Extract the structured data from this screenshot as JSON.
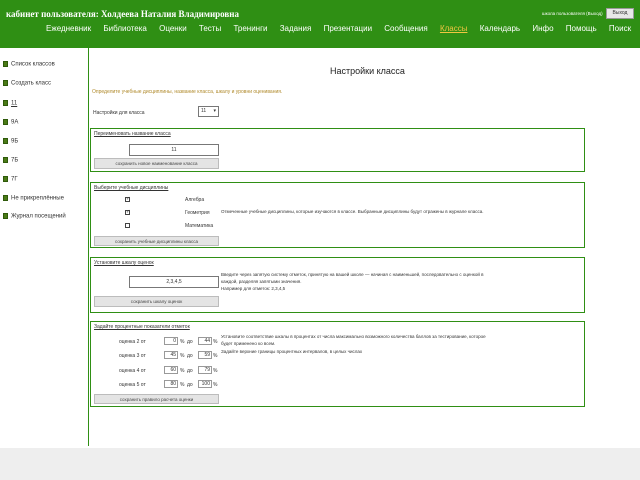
{
  "header": {
    "title": "кабинет пользователя: Холдеева Наталия Владимировна",
    "right_text": "школа пользователя (Выход)",
    "logout_label": "Выход"
  },
  "nav": [
    "Ежедневник",
    "Библиотека",
    "Оценки",
    "Тесты",
    "Тренинги",
    "Задания",
    "Презентации",
    "Сообщения",
    "Классы",
    "Календарь",
    "Инфо",
    "Помощь",
    "Поиск"
  ],
  "nav_active": "Классы",
  "sidebar": {
    "items": [
      {
        "label": "Список классов"
      },
      {
        "label": "Создать класс"
      },
      {
        "label": "11"
      },
      {
        "label": "9А"
      },
      {
        "label": "9Б"
      },
      {
        "label": "7Б"
      },
      {
        "label": "7Г"
      },
      {
        "label": "Не прикреплённые"
      },
      {
        "label": "Журнал посещений"
      }
    ]
  },
  "main": {
    "title": "Настройки класса",
    "intro": "Определите учебные дисциплины, название класса, шкалу и уровни оценивания.",
    "class_label": "Настройки для класса",
    "class_value": "11",
    "rename": {
      "legend": "Переименовать название класса",
      "value": "11",
      "button": "сохранить новое наименование класса"
    },
    "subjects": {
      "legend": "Выберите учебные дисциплины",
      "items": [
        {
          "name": "Алгебра",
          "checked": true
        },
        {
          "name": "Геометрия",
          "checked": true
        },
        {
          "name": "Математика",
          "checked": false
        }
      ],
      "note": "Отмеченные учебные дисциплины, которые изучаются в классе. Выбранные дисциплины будут отражены в журнале класса.",
      "button": "сохранить учебные дисциплины класса"
    },
    "scale": {
      "legend": "Установите шкалу оценок",
      "value": "2,3,4,5",
      "note_lines": [
        "Введите через запятую систему отметок, принятую на вашей школе — начиная с наименьшей, последовательно с оценкой в",
        "каждой, разделяя запятыми значения.",
        "Например для отметок: 2,3,4,5"
      ],
      "button": "сохранить шкалу оценок"
    },
    "grades": {
      "legend": "Задайте процентные показатели отметок",
      "rows": [
        {
          "label": "оценка 2 от",
          "from": "0",
          "to": "44"
        },
        {
          "label": "оценка 3 от",
          "from": "45",
          "to": "59"
        },
        {
          "label": "оценка 4 от",
          "from": "60",
          "to": "79"
        },
        {
          "label": "оценка 5 от",
          "from": "80",
          "to": "100"
        }
      ],
      "pct": "%",
      "to_label": "до",
      "note_lines": [
        "Установите соответствие шкалы в процентах от числа максимально возможного количества баллов за тестирование, которое",
        "будет применено ко всем.",
        "Задайте верхние границы процентных интервалов, в целых числах"
      ],
      "button": "сохранить правило расчета оценки"
    }
  },
  "colors": {
    "brand": "#2f8f14",
    "nav_active": "#f0c640",
    "intro": "#b08a2c"
  }
}
